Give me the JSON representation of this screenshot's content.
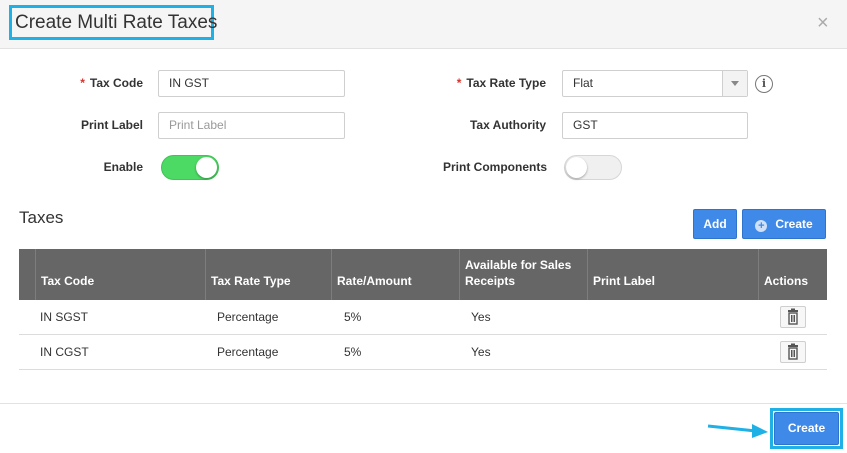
{
  "dialog": {
    "title": "Create Multi Rate Taxes",
    "close_icon": "×"
  },
  "form": {
    "tax_code": {
      "label": "Tax Code",
      "required_mark": "*",
      "value": "IN GST"
    },
    "tax_rate_type": {
      "label": "Tax Rate Type",
      "required_mark": "*",
      "value": "Flat",
      "info_icon": "i"
    },
    "print_label": {
      "label": "Print Label",
      "placeholder": "Print Label",
      "value": ""
    },
    "tax_authority": {
      "label": "Tax Authority",
      "value": "GST"
    },
    "enable": {
      "label": "Enable",
      "on": true
    },
    "print_components": {
      "label": "Print Components",
      "on": false
    }
  },
  "taxes": {
    "section_title": "Taxes",
    "add_label": "Add",
    "create_label": "Create",
    "create_icon": "+",
    "columns": [
      "Tax Code",
      "Tax Rate Type",
      "Rate/Amount",
      "Available for Sales Receipts",
      "Print Label",
      "Actions"
    ],
    "rows": [
      {
        "tax_code": "IN SGST",
        "tax_rate_type": "Percentage",
        "rate": "5%",
        "available": "Yes",
        "print_label": ""
      },
      {
        "tax_code": "IN CGST",
        "tax_rate_type": "Percentage",
        "rate": "5%",
        "available": "Yes",
        "print_label": ""
      }
    ]
  },
  "footer": {
    "create_label": "Create"
  },
  "colors": {
    "highlight": "#1fb0e6",
    "primary_button": "#3f8ae8",
    "toggle_on": "#4cd964",
    "table_header": "#666666",
    "required": "#d9342b"
  }
}
